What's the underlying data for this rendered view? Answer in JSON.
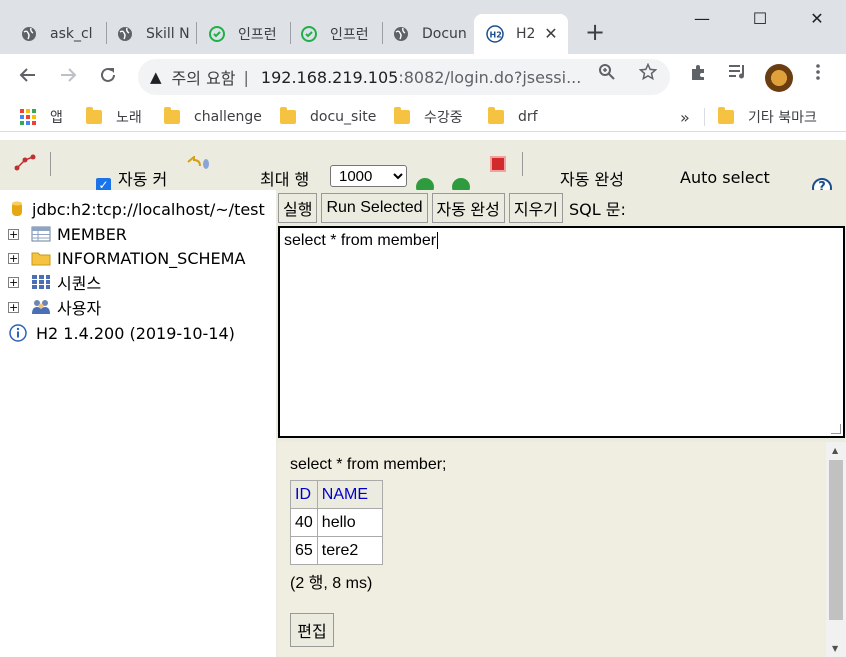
{
  "browser": {
    "tabs": [
      {
        "title": "ask_cl",
        "icon": "globe-icon",
        "active": false
      },
      {
        "title": "Skill N",
        "icon": "globe-icon",
        "active": false
      },
      {
        "title": "인프런",
        "icon": "inflearn-icon",
        "active": false
      },
      {
        "title": "인프런",
        "icon": "inflearn-icon",
        "active": false
      },
      {
        "title": "Docun",
        "icon": "globe-icon",
        "active": false
      },
      {
        "title": "H2",
        "icon": "h2-icon",
        "active": true,
        "close": "✕"
      }
    ],
    "new_tab": "+",
    "window": {
      "minimize": "—",
      "maximize": "☐",
      "close": "✕"
    },
    "address": {
      "warning_icon": "▲",
      "security_label": "주의 요함",
      "separator": "|",
      "host": "192.168.219.105",
      "path": ":8082/login.do?jsessi..."
    },
    "bookmarks": [
      {
        "label": "앱",
        "type": "apps"
      },
      {
        "label": "노래",
        "type": "folder"
      },
      {
        "label": "challenge",
        "type": "folder"
      },
      {
        "label": "docu_site",
        "type": "folder"
      },
      {
        "label": "수강중",
        "type": "folder"
      },
      {
        "label": "drf",
        "type": "folder"
      }
    ],
    "bookmarks_overflow": "»",
    "other_bookmarks": "기타 북마크"
  },
  "h2": {
    "toolbar": {
      "auto_commit_label": "자동 커",
      "max_rows_label": "최대 행",
      "max_rows_value": "1000",
      "auto_complete_label": "자동 완성",
      "auto_select_label": "Auto select",
      "help": "?"
    },
    "tree": [
      {
        "label": "jdbc:h2:tcp://localhost/~/test",
        "icon": "database-icon",
        "expandable": false
      },
      {
        "label": "MEMBER",
        "icon": "table-icon",
        "expandable": true
      },
      {
        "label": "INFORMATION_SCHEMA",
        "icon": "folder-icon",
        "expandable": true
      },
      {
        "label": "시퀀스",
        "icon": "sequence-icon",
        "expandable": true
      },
      {
        "label": "사용자",
        "icon": "users-icon",
        "expandable": true
      },
      {
        "label": "H2 1.4.200 (2019-10-14)",
        "icon": "info-icon",
        "expandable": false
      }
    ],
    "buttons": {
      "run": "실행",
      "run_selected": "Run Selected",
      "auto_complete": "자동 완성",
      "clear": "지우기",
      "sql_label": "SQL 문:"
    },
    "sql_text": "select * from member",
    "result": {
      "statement": "select * from member;",
      "columns": [
        "ID",
        "NAME"
      ],
      "rows": [
        [
          "40",
          "hello"
        ],
        [
          "65",
          "tere2"
        ]
      ],
      "summary": "(2 행, 8 ms)",
      "edit_button": "편집"
    }
  }
}
